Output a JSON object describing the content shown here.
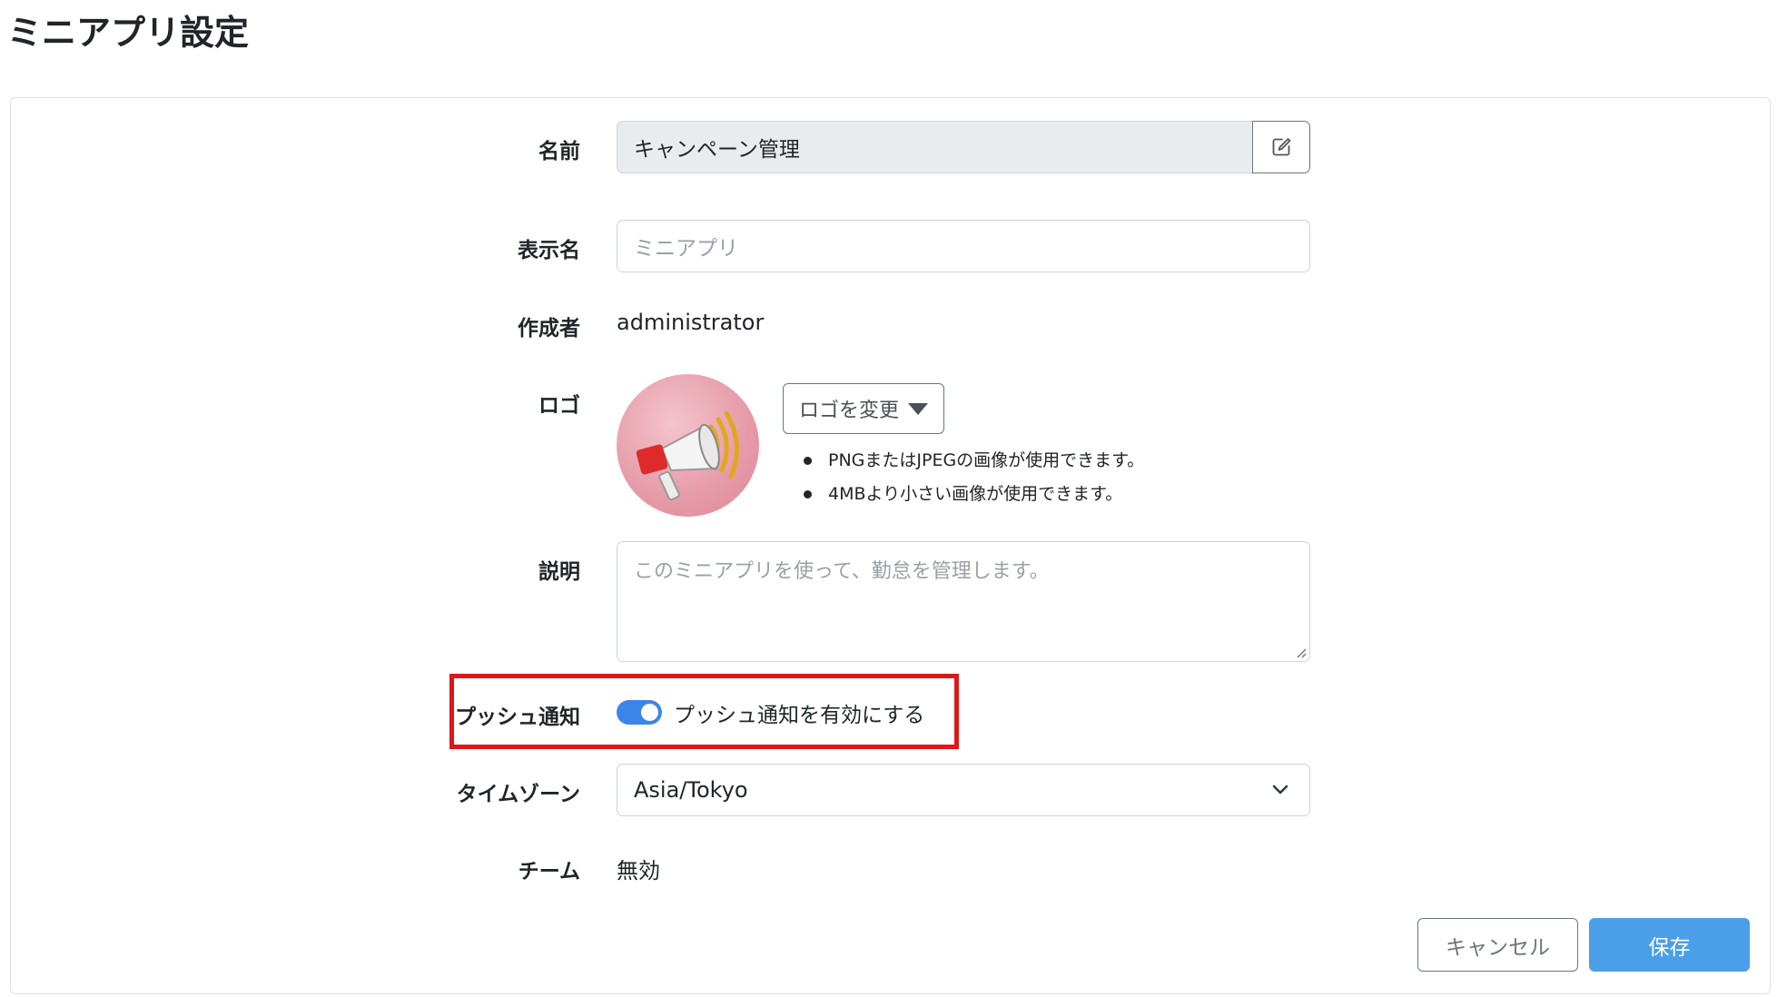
{
  "page": {
    "title": "ミニアプリ設定"
  },
  "form": {
    "name": {
      "label": "名前",
      "value": "キャンペーン管理"
    },
    "display_name": {
      "label": "表示名",
      "placeholder": "ミニアプリ"
    },
    "creator": {
      "label": "作成者",
      "value": "administrator"
    },
    "logo": {
      "label": "ロゴ",
      "change_button": "ロゴを変更",
      "notes": [
        "PNGまたはJPEGの画像が使用できます。",
        "4MBより小さい画像が使用できます。"
      ]
    },
    "description": {
      "label": "説明",
      "placeholder": "このミニアプリを使って、勤怠を管理します。"
    },
    "push": {
      "label": "プッシュ通知",
      "toggle_label": "プッシュ通知を有効にする",
      "enabled": true
    },
    "timezone": {
      "label": "タイムゾーン",
      "value": "Asia/Tokyo"
    },
    "team": {
      "label": "チーム",
      "value": "無効"
    }
  },
  "actions": {
    "cancel": "キャンセル",
    "save": "保存"
  },
  "colors": {
    "accent": "#4a9fe8",
    "toggle_on": "#3b86e6",
    "highlight_border": "#dd1818",
    "readonly_bg": "#e9ecef"
  }
}
